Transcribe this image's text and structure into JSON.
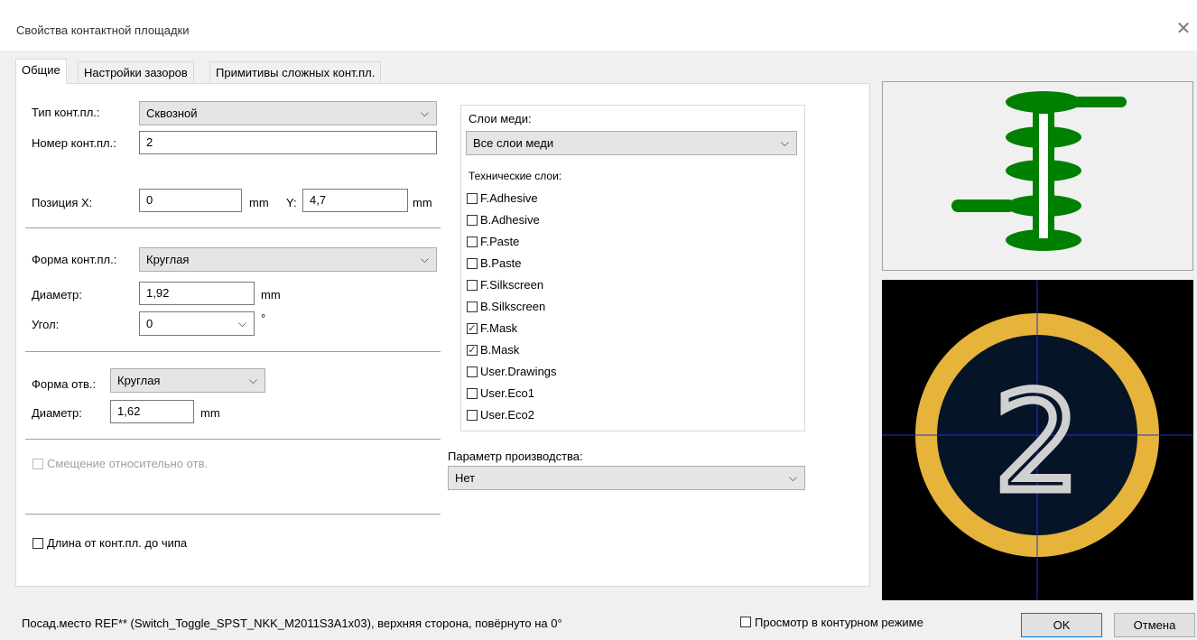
{
  "dialog": {
    "title": "Свойства контактной площадки"
  },
  "tabs": [
    "Общие",
    "Настройки зазоров",
    "Примитивы сложных конт.пл."
  ],
  "general": {
    "pad_type_label": "Тип конт.пл.:",
    "pad_type_value": "Сквозной",
    "pad_number_label": "Номер конт.пл.:",
    "pad_number_value": "2",
    "pos_x_label": "Позиция X:",
    "pos_x_value": "0",
    "pos_x_unit": "mm",
    "pos_y_label": "Y:",
    "pos_y_value": "4,7",
    "pos_y_unit": "mm",
    "shape_label": "Форма конт.пл.:",
    "shape_value": "Круглая",
    "diameter_label": "Диаметр:",
    "diameter_value": "1,92",
    "diameter_unit": "mm",
    "angle_label": "Угол:",
    "angle_value": "0",
    "angle_unit": "°",
    "hole_shape_label": "Форма отв.:",
    "hole_shape_value": "Круглая",
    "hole_diameter_label": "Диаметр:",
    "hole_diameter_value": "1,62",
    "hole_diameter_unit": "mm",
    "offset_label": "Смещение относительно отв.",
    "die_length_label": "Длина от конт.пл. до чипа"
  },
  "layers": {
    "copper_label": "Слои меди:",
    "copper_value": "Все слои меди",
    "tech_label": "Технические слои:",
    "items": [
      {
        "name": "F.Adhesive",
        "checked": false
      },
      {
        "name": "B.Adhesive",
        "checked": false
      },
      {
        "name": "F.Paste",
        "checked": false
      },
      {
        "name": "B.Paste",
        "checked": false
      },
      {
        "name": "F.Silkscreen",
        "checked": false
      },
      {
        "name": "B.Silkscreen",
        "checked": false
      },
      {
        "name": "F.Mask",
        "checked": true
      },
      {
        "name": "B.Mask",
        "checked": true
      },
      {
        "name": "User.Drawings",
        "checked": false
      },
      {
        "name": "User.Eco1",
        "checked": false
      },
      {
        "name": "User.Eco2",
        "checked": false
      }
    ]
  },
  "fabrication": {
    "label": "Параметр производства:",
    "value": "Нет"
  },
  "preview": {
    "pad_number": "2",
    "ring_color": "#e6b43a",
    "copper_color": "#008000",
    "crosshair_color": "#2030d0"
  },
  "footer": {
    "status": "Посад.место REF** (Switch_Toggle_SPST_NKK_M2011S3A1x03), верхняя сторона, повёрнуто на 0°",
    "outline_mode_label": "Просмотр в контурном режиме",
    "ok_label": "OK",
    "cancel_label": "Отмена"
  }
}
